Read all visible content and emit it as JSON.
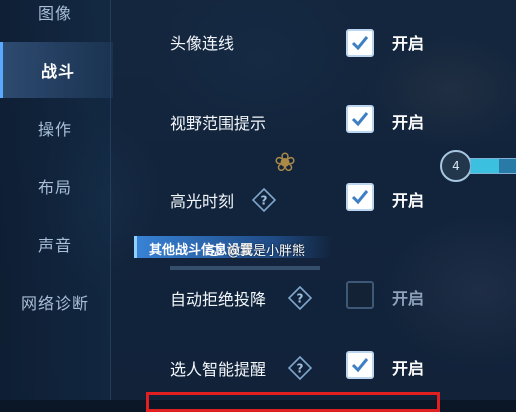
{
  "sidebar": {
    "items": [
      {
        "label": "图像",
        "active": false
      },
      {
        "label": "战斗",
        "active": true
      },
      {
        "label": "操作",
        "active": false
      },
      {
        "label": "布局",
        "active": false
      },
      {
        "label": "声音",
        "active": false
      },
      {
        "label": "网络诊断",
        "active": false
      }
    ]
  },
  "settings": {
    "rows": [
      {
        "label": "头像连线",
        "has_help": false,
        "checked": true,
        "state": "开启"
      },
      {
        "label": "视野范围提示",
        "has_help": false,
        "checked": true,
        "state": "开启"
      },
      {
        "label": "高光时刻",
        "has_help": true,
        "checked": true,
        "state": "开启"
      },
      {
        "label": "自动拒绝投降",
        "has_help": true,
        "checked": false,
        "state": "开启"
      },
      {
        "label": "选人智能提醒",
        "has_help": true,
        "checked": true,
        "state": "开启"
      }
    ],
    "section_header": "其他战斗信息设置"
  },
  "hud": {
    "level": "4"
  },
  "watermark": {
    "text": "@我是小胖熊"
  },
  "colors": {
    "accent": "#5aa8ff",
    "highlight_frame": "#e02020",
    "check": "#3f7fc4"
  },
  "icons": {
    "help": "question-diamond-icon",
    "check": "checkmark-icon"
  }
}
